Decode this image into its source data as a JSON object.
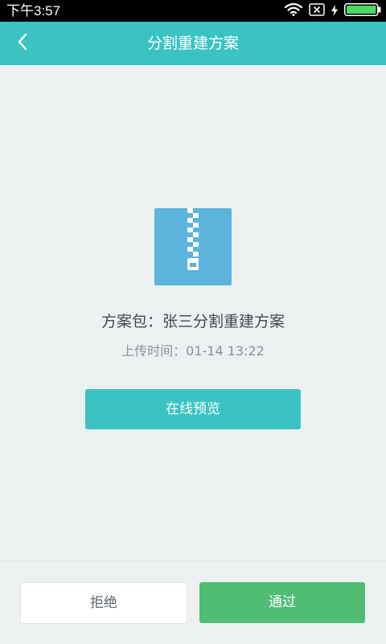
{
  "status_bar": {
    "time": "下午3:57",
    "icons": [
      "wifi-icon",
      "no-sim-icon",
      "charging-icon",
      "battery-icon"
    ],
    "battery_color": "#4cd964"
  },
  "app_bar": {
    "title": "分割重建方案",
    "back_icon": "chevron-left-icon",
    "color": "#3bc3c3"
  },
  "package": {
    "icon": "zip-file-icon",
    "icon_color": "#5ab4dc",
    "name_line": "方案包：张三分割重建方案",
    "upload_time_line": "上传时间：01-14 13:22"
  },
  "actions": {
    "preview_label": "在线预览",
    "reject_label": "拒绝",
    "approve_label": "通过",
    "approve_color": "#4fbe74"
  }
}
